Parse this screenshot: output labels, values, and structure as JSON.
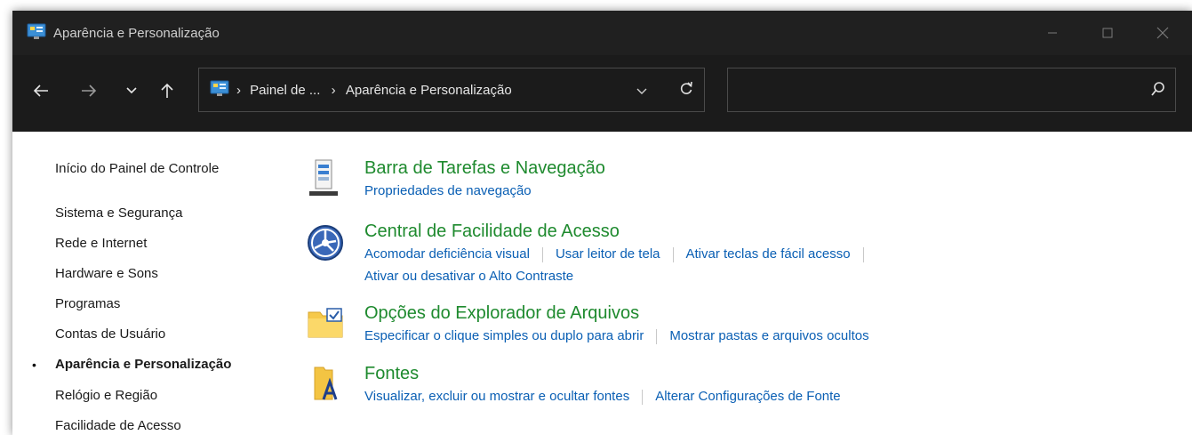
{
  "window": {
    "title": "Aparência e Personalização",
    "controls": {
      "minimize_icon": "minimize-icon",
      "maximize_icon": "maximize-icon",
      "close_icon": "close-icon"
    }
  },
  "navigation": {
    "breadcrumb": [
      "Painel de ...",
      "Aparência e Personalização"
    ],
    "separator": "›",
    "search_placeholder": ""
  },
  "sidebar": {
    "items": [
      {
        "label": "Início do Painel de Controle",
        "current": false
      },
      {
        "label": "Sistema e Segurança",
        "current": false
      },
      {
        "label": "Rede e Internet",
        "current": false
      },
      {
        "label": "Hardware e Sons",
        "current": false
      },
      {
        "label": "Programas",
        "current": false
      },
      {
        "label": "Contas de Usuário",
        "current": false
      },
      {
        "label": "Aparência e Personalização",
        "current": true
      },
      {
        "label": "Relógio e Região",
        "current": false
      },
      {
        "label": "Facilidade de Acesso",
        "current": false
      }
    ],
    "bullet": "•"
  },
  "categories": [
    {
      "title": "Barra de Tarefas e Navegação",
      "icon": "taskbar-icon",
      "links": [
        [
          "Propriedades de navegação"
        ]
      ]
    },
    {
      "title": "Central de Facilidade de Acesso",
      "icon": "ease-of-access-icon",
      "links": [
        [
          "Acomodar deficiência visual",
          "Usar leitor de tela",
          "Ativar teclas de fácil acesso"
        ],
        [
          "Ativar ou desativar o Alto Contraste"
        ]
      ]
    },
    {
      "title": "Opções do Explorador de Arquivos",
      "icon": "folder-options-icon",
      "links": [
        [
          "Especificar o clique simples ou duplo para abrir",
          "Mostrar pastas e arquivos ocultos"
        ]
      ]
    },
    {
      "title": "Fontes",
      "icon": "fonts-icon",
      "links": [
        [
          "Visualizar, excluir ou mostrar e ocultar fontes",
          "Alterar Configurações de Fonte"
        ]
      ]
    }
  ],
  "colors": {
    "titlebar_bg": "#202020",
    "navbar_bg": "#1b1b1b",
    "heading_green": "#1e8a2e",
    "link_blue": "#0a5fb4"
  }
}
